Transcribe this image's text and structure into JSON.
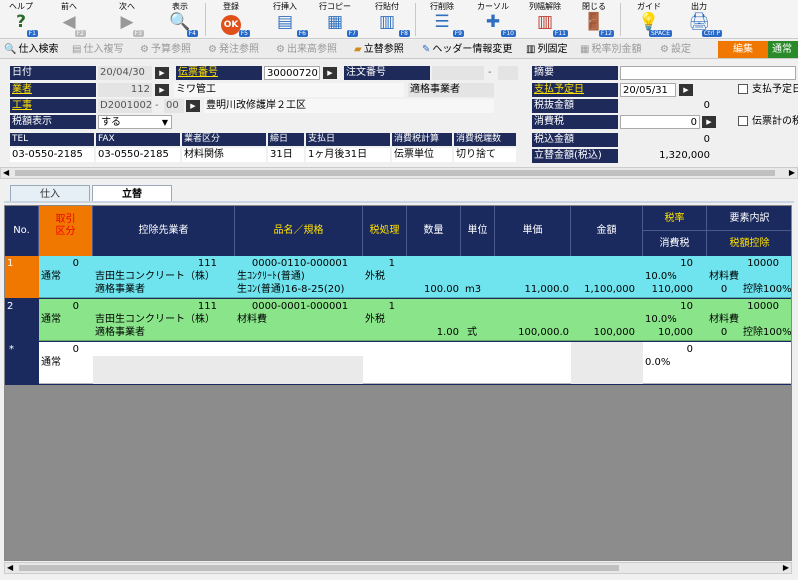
{
  "toolbar": {
    "items": [
      {
        "label": "ヘルプ",
        "key": "F1",
        "icon": "help-icon"
      },
      {
        "label": "前へ",
        "key": "F2",
        "icon": "arrow-left-icon"
      },
      {
        "label": "次へ",
        "key": "F3",
        "icon": "arrow-right-icon"
      },
      {
        "label": "表示",
        "key": "F4",
        "icon": "magnifier-icon"
      },
      {
        "label": "登録",
        "key": "F5",
        "icon": "ok-icon"
      },
      {
        "label": "行挿入",
        "key": "F6",
        "icon": "insert-row-icon"
      },
      {
        "label": "行コピー",
        "key": "F7",
        "icon": "copy-row-icon"
      },
      {
        "label": "行貼付",
        "key": "F8",
        "icon": "paste-row-icon"
      },
      {
        "label": "行削除",
        "key": "F9",
        "icon": "delete-row-icon"
      },
      {
        "label": "カーソル",
        "key": "F10",
        "icon": "cursor-icon"
      },
      {
        "label": "列幅解除",
        "key": "F11",
        "icon": "column-width-icon"
      },
      {
        "label": "閉じる",
        "key": "F12",
        "icon": "close-door-icon"
      },
      {
        "label": "ガイド",
        "key": "SPACE",
        "icon": "lightbulb-icon"
      },
      {
        "label": "出力",
        "key": "Ctrl P",
        "icon": "print-icon"
      }
    ]
  },
  "subbar": {
    "items": [
      {
        "label": "仕入検索",
        "enabled": true
      },
      {
        "label": "仕入複写",
        "enabled": false
      },
      {
        "label": "予算参照",
        "enabled": false
      },
      {
        "label": "発注参照",
        "enabled": false
      },
      {
        "label": "出来高参照",
        "enabled": false
      },
      {
        "label": "立替参照",
        "enabled": true
      },
      {
        "label": "ヘッダー情報変更",
        "enabled": true
      },
      {
        "label": "列固定",
        "enabled": true
      },
      {
        "label": "税率別金額",
        "enabled": false
      },
      {
        "label": "設定",
        "enabled": false
      }
    ],
    "mode_edit": "編集",
    "mode_next": "通常"
  },
  "header": {
    "date_label": "日付",
    "date": "20/04/30",
    "slip_label": "伝票番号",
    "slip_no": "30000720",
    "order_label": "注文番号",
    "order_dash": "-",
    "vendor_label": "業者",
    "vendor_code": "112",
    "vendor_name": "ミワ管工",
    "vendor_type": "適格事業者",
    "project_label": "工事",
    "project_code": "D2001002",
    "project_sep": "-",
    "project_sub": "00",
    "project_name": "豊明川改修護岸２工区",
    "taxdisp_label": "税額表示",
    "taxdisp": "する",
    "summary_label": "摘要",
    "paydate_label": "支払予定日",
    "paydate": "20/05/31",
    "pay_check_label": "支払予定日",
    "notax_label": "税抜金額",
    "notax": "0",
    "tax_label": "消費税",
    "tax": "0",
    "slip_check_label": "伝票計の税",
    "taxin_label": "税込金額",
    "taxin": "0",
    "reimb_label": "立替金額(税込)",
    "reimb": "1,320,000"
  },
  "info": {
    "headers": [
      "TEL",
      "FAX",
      "業者区分",
      "締日",
      "支払日",
      "消費税計算",
      "消費税端数"
    ],
    "values": [
      "03-0550-2185",
      "03-0550-2185",
      "材料関係",
      "31日",
      "1ヶ月後31日",
      "伝票単位",
      "切り捨て"
    ]
  },
  "tabs": [
    "仕入",
    "立替"
  ],
  "grid": {
    "headers": {
      "no": "No.",
      "kubun": "取引区分",
      "koujo": "控除先業者",
      "hinmei": "品名／規格",
      "zei": "税処理",
      "suryo": "数量",
      "tani": "単位",
      "tanka": "単価",
      "kingaku": "金額",
      "zeiritsu": "税率",
      "shohizei": "消費税",
      "yoso": "要素内訳",
      "zeigaku": "税額控除"
    },
    "rows": [
      {
        "no": "1",
        "kubun_code": "0",
        "kubun": "通常",
        "koujo_code": "111",
        "koujo_name": "吉田生コンクリート（株）",
        "koujo_type": "適格事業者",
        "item_code": "0000-0110-000001",
        "item_name": "生ｺﾝｸﾘｰﾄ(普通)",
        "item_spec": "生ｺﾝ(普通)16-8-25(20)",
        "zei_code": "1",
        "zei": "外税",
        "suryo": "100.00",
        "tani": "m3",
        "tanka": "11,000.0",
        "kingaku": "1,100,000",
        "rate_code": "10",
        "rate": "10.0%",
        "tax": "110,000",
        "yoso_code": "10000",
        "yoso": "材料費",
        "yoso_zero": "0",
        "koujo_pct": "控除100%"
      },
      {
        "no": "2",
        "kubun_code": "0",
        "kubun": "通常",
        "koujo_code": "111",
        "koujo_name": "吉田生コンクリート（株）",
        "koujo_type": "適格事業者",
        "item_code": "0000-0001-000001",
        "item_name": "材料費",
        "item_spec": "",
        "zei_code": "1",
        "zei": "外税",
        "suryo": "1.00",
        "tani": "式",
        "tanka": "100,000.0",
        "kingaku": "100,000",
        "rate_code": "10",
        "rate": "10.0%",
        "tax": "10,000",
        "yoso_code": "10000",
        "yoso": "材料費",
        "yoso_zero": "0",
        "koujo_pct": "控除100%"
      },
      {
        "no": "*",
        "kubun_code": "0",
        "kubun": "通常",
        "rate_code": "0",
        "rate": "0.0%"
      }
    ]
  }
}
